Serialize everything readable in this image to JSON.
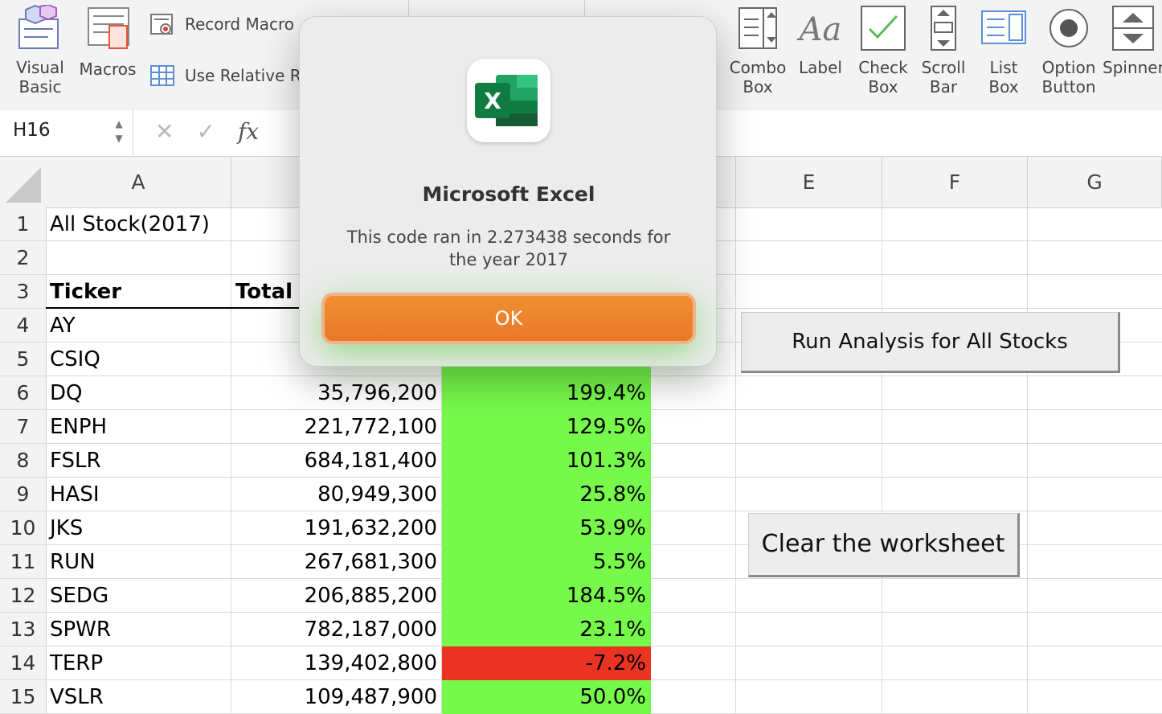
{
  "ribbon": {
    "visual_basic": "Visual\nBasic",
    "macros": "Macros",
    "record_macro": "Record Macro",
    "use_relative": "Use Relative R",
    "controls": [
      {
        "label": "Combo\nBox",
        "icon": "combo-box-icon"
      },
      {
        "label": "Label",
        "icon": "label-icon"
      },
      {
        "label": "Check\nBox",
        "icon": "check-box-icon"
      },
      {
        "label": "Scroll\nBar",
        "icon": "scroll-bar-icon"
      },
      {
        "label": "List\nBox",
        "icon": "list-box-icon"
      },
      {
        "label": "Option\nButton",
        "icon": "option-button-icon"
      },
      {
        "label": "Spinner",
        "icon": "spinner-icon"
      }
    ]
  },
  "formula_bar": {
    "name_box": "H16",
    "fx": "fx"
  },
  "sheet": {
    "columns": [
      "A",
      "",
      "",
      "",
      "E",
      "F",
      "G"
    ],
    "rows": [
      "1",
      "2",
      "3",
      "4",
      "5",
      "6",
      "7",
      "8",
      "9",
      "10",
      "11",
      "12",
      "13",
      "14",
      "15"
    ],
    "title": "All Stock(2017)",
    "header_ticker": "Ticker",
    "header_total": "Total D",
    "tickers": [
      "AY",
      "CSIQ",
      "DQ",
      "ENPH",
      "FSLR",
      "HASI",
      "JKS",
      "RUN",
      "SEDG",
      "SPWR",
      "TERP",
      "VSLR"
    ],
    "volumes": [
      "",
      "",
      "35,796,200",
      "221,772,100",
      "684,181,400",
      "80,949,300",
      "191,632,200",
      "267,681,300",
      "206,885,200",
      "782,187,000",
      "139,402,800",
      "109,487,900"
    ],
    "returns": [
      "",
      "",
      "199.4%",
      "129.5%",
      "101.3%",
      "25.8%",
      "53.9%",
      "5.5%",
      "184.5%",
      "23.1%",
      "-7.2%",
      "50.0%"
    ],
    "return_colors": [
      "#76f94b",
      "#76f94b",
      "#76f94b",
      "#76f94b",
      "#76f94b",
      "#76f94b",
      "#76f94b",
      "#76f94b",
      "#76f94b",
      "#76f94b",
      "#ea3323",
      "#76f94b"
    ],
    "run_button": "Run Analysis for All Stocks",
    "clear_button": "Clear the worksheet"
  },
  "dialog": {
    "app_name": "Microsoft Excel",
    "message": "This code ran in 2.273438 seconds for the year 2017",
    "ok": "OK"
  }
}
